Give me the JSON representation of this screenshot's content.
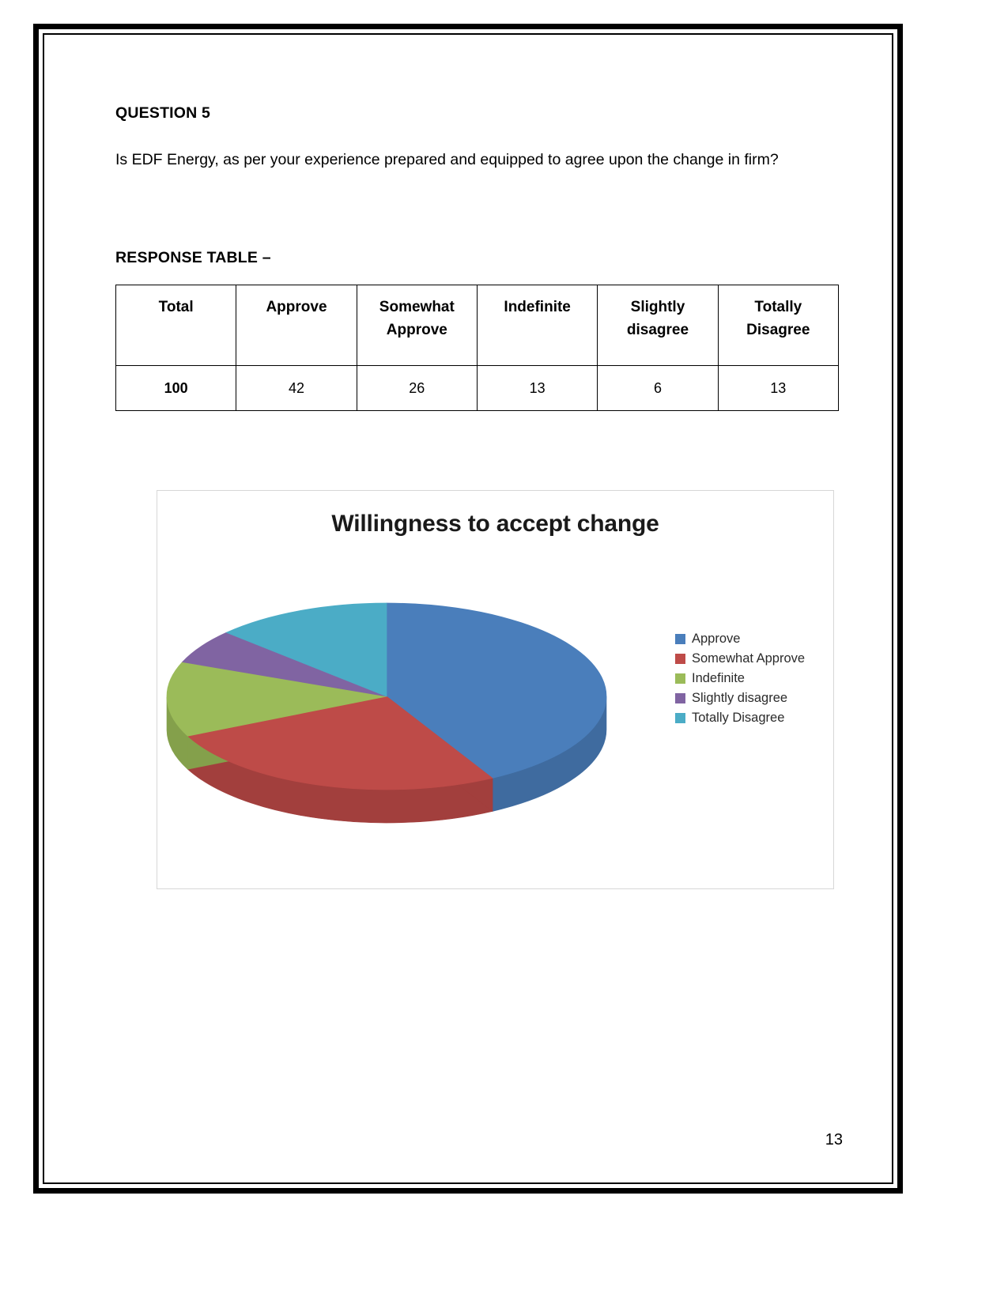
{
  "document": {
    "question_heading": "QUESTION 5",
    "question_text_line1": "Is EDF Energy, as per your experience prepared and equipped to agree upon the",
    "question_text_line2": "change in firm?",
    "section_heading": "RESPONSE TABLE –",
    "page_number": "13"
  },
  "table": {
    "headers": [
      "Total",
      "Approve",
      "Somewhat Approve",
      "Indefinite",
      "Slightly disagree",
      "Totally Disagree"
    ],
    "header_lines": [
      [
        "Total"
      ],
      [
        "Approve"
      ],
      [
        "Somewhat",
        "Approve"
      ],
      [
        "Indefinite"
      ],
      [
        "Slightly",
        "disagree"
      ],
      [
        "Totally",
        "Disagree"
      ]
    ],
    "values": [
      "100",
      "42",
      "26",
      "13",
      "6",
      "13"
    ]
  },
  "chart_data": {
    "type": "pie",
    "title": "Willingness to accept change",
    "categories": [
      "Approve",
      "Somewhat Approve",
      "Indefinite",
      "Slightly disagree",
      "Totally Disagree"
    ],
    "values": [
      42,
      26,
      13,
      6,
      13
    ],
    "total": 100,
    "colors": [
      "#4a7ebb",
      "#be4b48",
      "#9bbb59",
      "#8064a2",
      "#4bacc6"
    ],
    "side_colors": [
      "#3f6b9f",
      "#a23f3d",
      "#84a04b",
      "#6c548a",
      "#3f92a8"
    ],
    "legend_position": "right",
    "three_d": true,
    "xlabel": "",
    "ylabel": ""
  },
  "legend": {
    "items": [
      {
        "label": "Approve",
        "color": "#4a7ebb"
      },
      {
        "label": "Somewhat Approve",
        "color": "#be4b48"
      },
      {
        "label": "Indefinite",
        "color": "#9bbb59"
      },
      {
        "label": "Slightly disagree",
        "color": "#8064a2"
      },
      {
        "label": "Totally Disagree",
        "color": "#4bacc6"
      }
    ]
  }
}
